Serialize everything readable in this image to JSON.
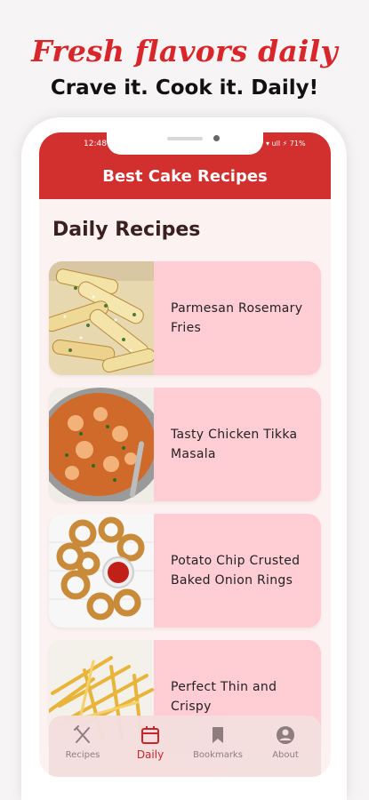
{
  "promo": {
    "headline": "Fresh flavors daily",
    "subline": "Crave it. Cook it. Daily!"
  },
  "status_bar": {
    "time": "12:48",
    "indicators": "▾ ull ⚡ 71%"
  },
  "app_bar": {
    "title": "Best Cake Recipes"
  },
  "section": {
    "title": "Daily Recipes"
  },
  "recipes": [
    {
      "title": "Parmesan Rosemary Fries",
      "image": "fries-image"
    },
    {
      "title": "Tasty Chicken Tikka Masala",
      "image": "tikka-masala-image"
    },
    {
      "title": "Potato Chip Crusted Baked Onion Rings",
      "image": "onion-rings-image"
    },
    {
      "title": "Perfect Thin and Crispy",
      "image": "thin-fries-image"
    }
  ],
  "nav": {
    "items": [
      {
        "label": "Recipes",
        "icon": "utensils-icon"
      },
      {
        "label": "Daily",
        "icon": "calendar-icon",
        "active": true
      },
      {
        "label": "Bookmarks",
        "icon": "bookmark-icon"
      },
      {
        "label": "About",
        "icon": "account-icon"
      }
    ]
  },
  "colors": {
    "brand_red": "#d22f2f",
    "card_pink": "#ffcdd3",
    "active_nav": "#c71f26"
  }
}
